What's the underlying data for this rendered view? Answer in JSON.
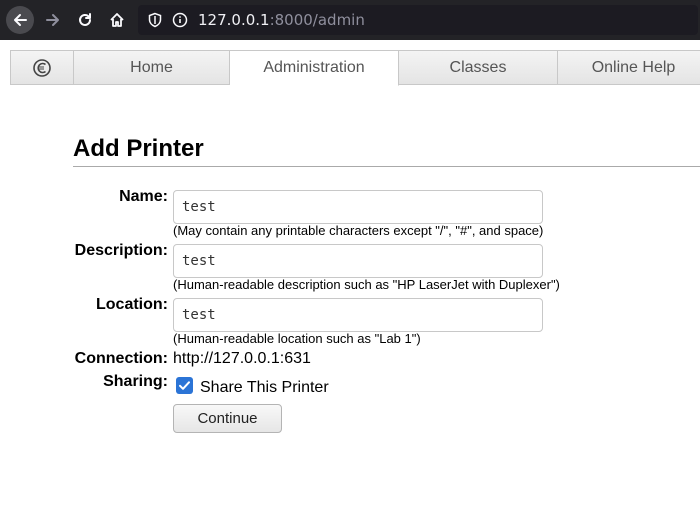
{
  "browser": {
    "url_host": "127.0.0.1",
    "url_rest": ":8000/admin"
  },
  "tabs": {
    "home": "Home",
    "administration": "Administration",
    "classes": "Classes",
    "online_help": "Online Help"
  },
  "page": {
    "title": "Add Printer"
  },
  "form": {
    "name": {
      "label": "Name:",
      "value": "test",
      "hint": "(May contain any printable characters except \"/\", \"#\", and space)"
    },
    "description": {
      "label": "Description:",
      "value": "test",
      "hint": "(Human-readable description such as \"HP LaserJet with Duplexer\")"
    },
    "location": {
      "label": "Location:",
      "value": "test",
      "hint": "(Human-readable location such as \"Lab 1\")"
    },
    "connection": {
      "label": "Connection:",
      "value": "http://127.0.0.1:631"
    },
    "sharing": {
      "label": "Sharing:",
      "checkbox_label": "Share This Printer",
      "checked": true
    },
    "continue_label": "Continue"
  },
  "colors": {
    "accent": "#2b74d6",
    "browser_chrome": "#232327"
  }
}
